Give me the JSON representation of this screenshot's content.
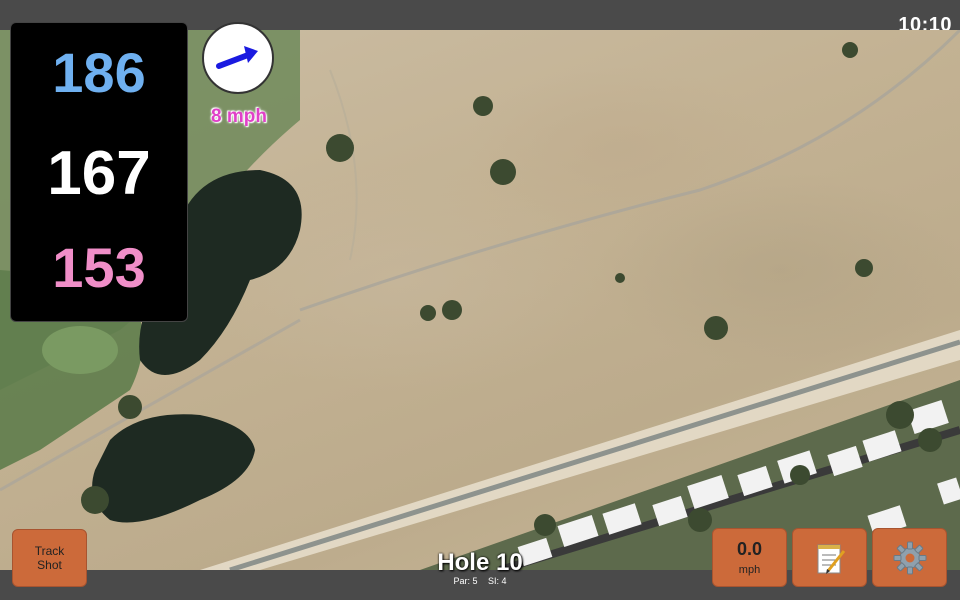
{
  "status": {
    "time": "10:10"
  },
  "distances": {
    "back": "186",
    "middle": "167",
    "front": "153"
  },
  "wind": {
    "speed_label": "8 mph",
    "direction_icon": "arrow-icon"
  },
  "buttons": {
    "track_shot": "Track Shot",
    "speed_value": "0.0",
    "speed_unit": "mph",
    "notes_icon": "notepad-icon",
    "settings_icon": "gear-icon"
  },
  "hole": {
    "title": "Hole 10",
    "par": "Par: 5",
    "si": "SI: 4"
  },
  "colors": {
    "back_distance": "#6fb0f0",
    "middle_distance": "#ffffff",
    "front_distance": "#f08ec8",
    "wind_speed": "#e040c8",
    "button": "#cc6a3a"
  }
}
